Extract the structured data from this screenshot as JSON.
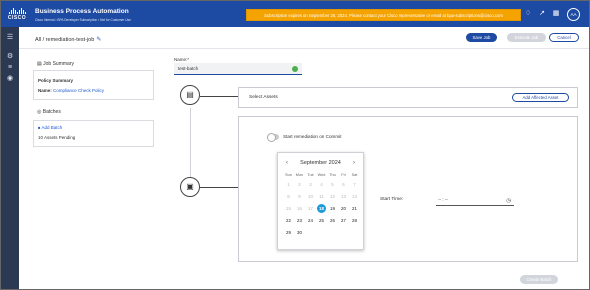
{
  "header": {
    "brand_word": "CISCO",
    "app_title": "Business Process Automation",
    "app_subtitle": "Cisco Internal • BPA Developer Subscription • Not for Customer Use",
    "subscription_banner": "Subscription expires on September 26, 2024. Please contact your Cisco representative or email at bpa-subscriptions@cisco.com",
    "avatar_initials": "AA",
    "colors": {
      "header_bg": "#1d4aa3",
      "banner_bg": "#f4a300"
    }
  },
  "toolbar": {
    "breadcrumb": "All / remediation-test-job",
    "save_label": "Save Job",
    "execute_label": "Execute Job",
    "cancel_label": "Cancel"
  },
  "sidebar": {
    "job_summary_title": "Job Summary",
    "policy_summary_label": "Policy Summary",
    "name_label": "Name:",
    "name_value": "Compliance Check Policy",
    "batches_title": "Batches",
    "add_batch_label": "Add Batch",
    "assets_pending": "10 Assets Pending"
  },
  "form": {
    "name_label": "Name:*",
    "name_value": "test-batch",
    "select_assets_label": "Select Assets",
    "add_asset_label": "Add Affected Asset",
    "remediation_toggle_label": "Start remediation on Commit",
    "start_time_label": "Start Time:",
    "start_time_value": "-- : --",
    "create_batch_label": "Create Batch"
  },
  "calendar": {
    "month_label": "September 2024",
    "weekdays": [
      "Sun",
      "Mon",
      "Tue",
      "Wed",
      "Thu",
      "Fri",
      "Sat"
    ],
    "weeks": [
      [
        "1",
        "2",
        "3",
        "4",
        "5",
        "6",
        "7"
      ],
      [
        "8",
        "9",
        "10",
        "11",
        "12",
        "13",
        "14"
      ],
      [
        "15",
        "16",
        "17",
        "18",
        "19",
        "20",
        "21"
      ],
      [
        "22",
        "23",
        "24",
        "25",
        "26",
        "27",
        "28"
      ],
      [
        "29",
        "30",
        "",
        "",
        "",
        "",
        ""
      ]
    ],
    "selected_day": "18",
    "first_enabled_day": 18,
    "accent_color": "#1d9ad8"
  }
}
